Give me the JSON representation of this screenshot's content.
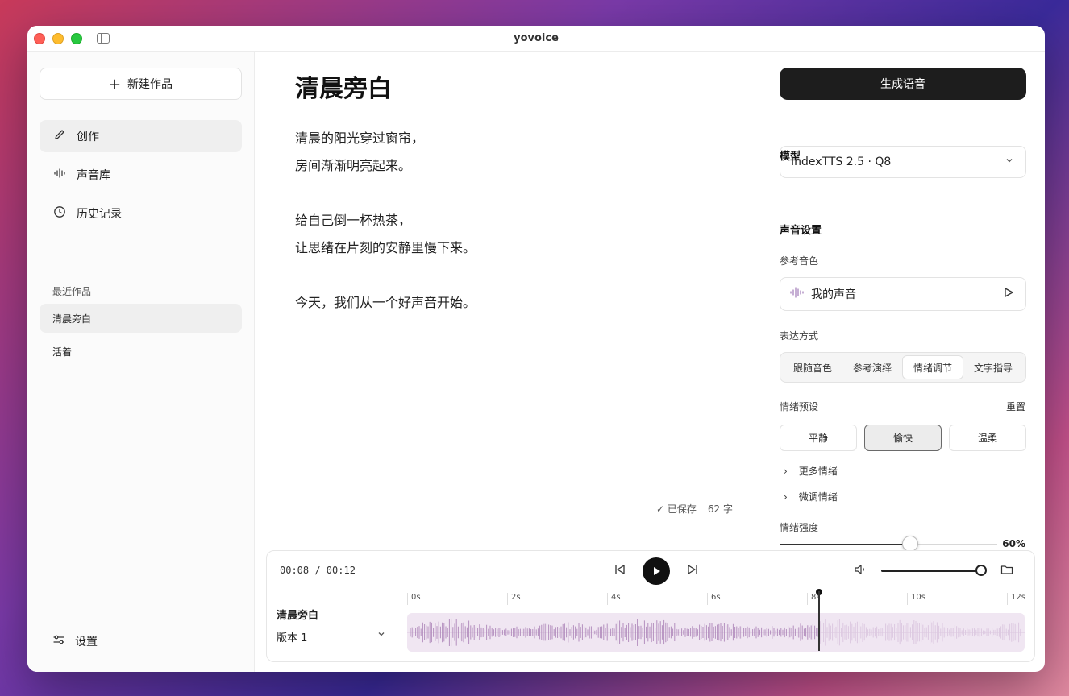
{
  "window": {
    "title": "yovoice"
  },
  "sidebar": {
    "new_label": "新建作品",
    "nav": [
      {
        "label": "创作",
        "icon": "pencil-icon",
        "active": true
      },
      {
        "label": "声音库",
        "icon": "waveform-icon",
        "active": false
      },
      {
        "label": "历史记录",
        "icon": "clock-icon",
        "active": false
      }
    ],
    "recent_label": "最近作品",
    "recent": [
      {
        "label": "清晨旁白",
        "active": true
      },
      {
        "label": "活着",
        "active": false
      }
    ],
    "settings_label": "设置"
  },
  "editor": {
    "title": "清晨旁白",
    "paragraphs": [
      [
        "清晨的阳光穿过窗帘，",
        "房间渐渐明亮起来。"
      ],
      [
        "给自己倒一杯热茶，",
        "让思绪在片刻的安静里慢下来。"
      ],
      [
        "今天，我们从一个好声音开始。"
      ]
    ],
    "saved": "已保存",
    "count": "62 字"
  },
  "panel": {
    "generate": "生成语音",
    "model_label": "模型",
    "model_value": "IndexTTS 2.5 · Q8",
    "voice_settings": "声音设置",
    "ref_voice_label": "参考音色",
    "ref_voice_value": "我的声音",
    "expression_label": "表达方式",
    "expression_options": [
      "跟随音色",
      "参考演绎",
      "情绪调节",
      "文字指导"
    ],
    "expression_selected": 2,
    "emotion_preset_label": "情绪预设",
    "reset": "重置",
    "presets": [
      "平静",
      "愉快",
      "温柔"
    ],
    "preset_selected": 1,
    "more_emotions": "更多情绪",
    "fine_tune": "微调情绪",
    "intensity_label": "情绪强度",
    "intensity": 0.6,
    "intensity_text": "60%"
  },
  "player": {
    "current": "00:08",
    "total": "/ 00:12",
    "progress": 0.667,
    "volume": 1.0,
    "track_title": "清晨旁白",
    "version": "版本 1",
    "ticks": [
      "0s",
      "2s",
      "4s",
      "6s",
      "8s",
      "10s",
      "12s"
    ]
  },
  "colors": {
    "accent": "#1d1d1d",
    "wave_played": "#b48fbe",
    "wave_unplayed": "#dcc8e0",
    "wave_bg": "#f0e6f2"
  }
}
